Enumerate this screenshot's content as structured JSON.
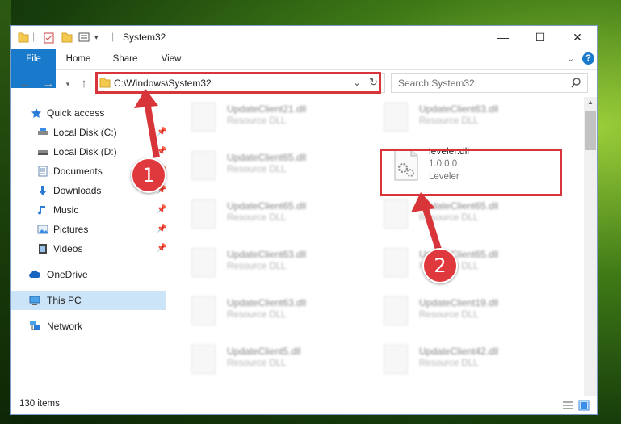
{
  "window": {
    "title": "System32"
  },
  "ribbon": {
    "tabs": [
      "File",
      "Home",
      "Share",
      "View"
    ]
  },
  "address": {
    "path": "C:\\Windows\\System32"
  },
  "search": {
    "placeholder": "Search System32"
  },
  "sidebar": {
    "items": [
      {
        "label": "Quick access",
        "icon": "star-icon"
      },
      {
        "label": "Local Disk (C:)",
        "icon": "drive-icon",
        "pinned": true
      },
      {
        "label": "Local Disk (D:)",
        "icon": "drive-icon",
        "pinned": true
      },
      {
        "label": "Documents",
        "icon": "documents-icon",
        "pinned": true
      },
      {
        "label": "Downloads",
        "icon": "download-icon",
        "pinned": true
      },
      {
        "label": "Music",
        "icon": "music-icon",
        "pinned": true
      },
      {
        "label": "Pictures",
        "icon": "pictures-icon",
        "pinned": true
      },
      {
        "label": "Videos",
        "icon": "videos-icon",
        "pinned": true
      },
      {
        "label": "OneDrive",
        "icon": "cloud-icon"
      },
      {
        "label": "This PC",
        "icon": "computer-icon",
        "selected": true
      },
      {
        "label": "Network",
        "icon": "network-icon"
      }
    ]
  },
  "files": {
    "left": [
      {
        "name": "UpdateClient21.dll",
        "type": "Resource DLL"
      },
      {
        "name": "UpdateClient65.dll",
        "type": "Resource DLL"
      },
      {
        "name": "UpdateClient65.dll",
        "type": "Resource DLL"
      },
      {
        "name": "UpdateClient63.dll",
        "type": "Resource DLL"
      },
      {
        "name": "UpdateClient63.dll",
        "type": "Resource DLL"
      },
      {
        "name": "UpdateClient5.dll",
        "type": "Resource DLL"
      }
    ],
    "right": [
      {
        "name": "UpdateClient63.dll",
        "type": "Resource DLL"
      },
      {
        "name": "UpdateClient65.dll",
        "type": "Resource DLL"
      },
      {
        "name": "UpdateClient65.dll",
        "type": "Resource DLL"
      },
      {
        "name": "UpdateClient19.dll",
        "type": "Resource DLL"
      },
      {
        "name": "UpdateClient42.dll",
        "type": "Resource DLL"
      }
    ],
    "highlighted": {
      "name": "leveler.dll",
      "version": "1.0.0.0",
      "description": "Leveler"
    }
  },
  "status": {
    "items": "130 items"
  },
  "callouts": [
    "1",
    "2"
  ],
  "colors": {
    "accent": "#1979ca",
    "highlight": "#d8353b",
    "selected": "#cce4f7"
  }
}
